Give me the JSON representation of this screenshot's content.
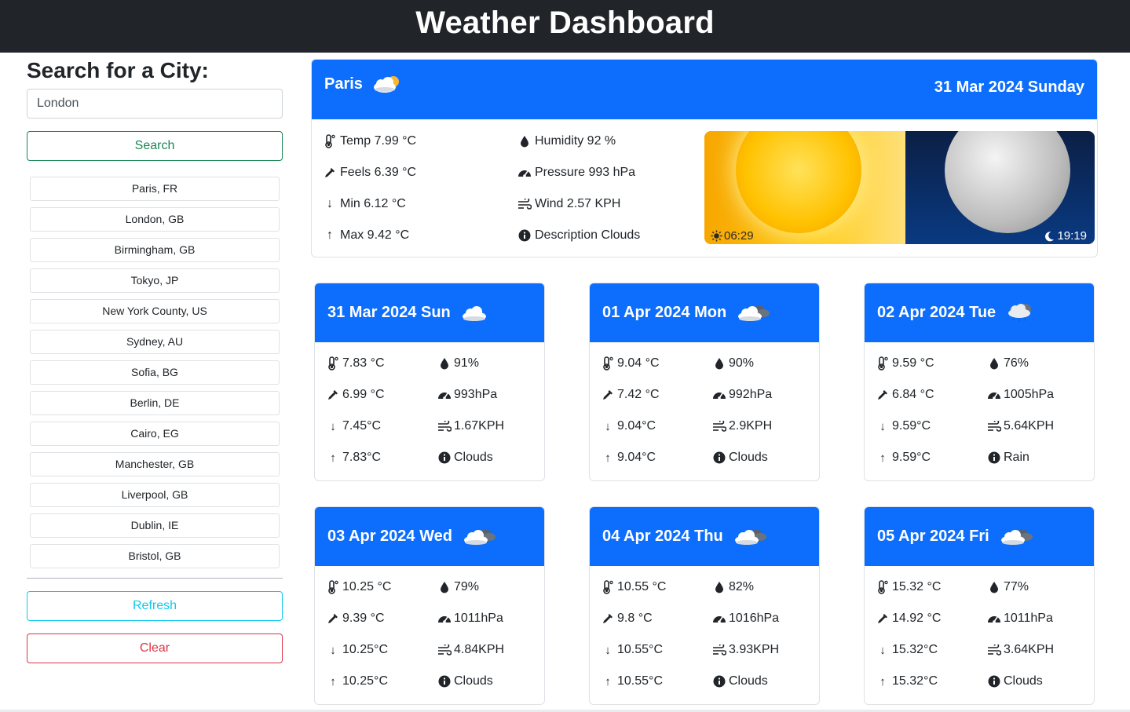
{
  "app": {
    "title": "Weather Dashboard"
  },
  "search": {
    "heading": "Search for a City:",
    "value": "London",
    "search_label": "Search",
    "refresh_label": "Refresh",
    "clear_label": "Clear"
  },
  "history": [
    "Paris, FR",
    "London, GB",
    "Birmingham, GB",
    "Tokyo, JP",
    "New York County, US",
    "Sydney, AU",
    "Sofia, BG",
    "Berlin, DE",
    "Cairo, EG",
    "Manchester, GB",
    "Liverpool, GB",
    "Dublin, IE",
    "Bristol, GB"
  ],
  "current": {
    "city": "Paris",
    "date": "31 Mar 2024 Sunday",
    "icon": "cloud-sun-icon",
    "temp": "Temp 7.99 °C",
    "feels": "Feels 6.39 °C",
    "min": "Min 6.12 °C",
    "max": "Max 9.42 °C",
    "humidity": "Humidity 92 %",
    "pressure": "Pressure 993 hPa",
    "wind": "Wind 2.57 KPH",
    "description": "Description Clouds",
    "sunrise": "06:29",
    "sunset": "19:19"
  },
  "forecast": [
    {
      "date": "31 Mar 2024 Sun",
      "icon": "cloud-icon",
      "temp": "7.83 °C",
      "feels": "6.99 °C",
      "min": "7.45°C",
      "max": "7.83°C",
      "humidity": "91%",
      "pressure": "993hPa",
      "wind": "1.67KPH",
      "desc": "Clouds"
    },
    {
      "date": "01 Apr 2024 Mon",
      "icon": "cloud-dark-icon",
      "temp": "9.04 °C",
      "feels": "7.42 °C",
      "min": "9.04°C",
      "max": "9.04°C",
      "humidity": "90%",
      "pressure": "992hPa",
      "wind": "2.9KPH",
      "desc": "Clouds"
    },
    {
      "date": "02 Apr 2024 Tue",
      "icon": "rain-cloud-icon",
      "temp": "9.59 °C",
      "feels": "6.84 °C",
      "min": "9.59°C",
      "max": "9.59°C",
      "humidity": "76%",
      "pressure": "1005hPa",
      "wind": "5.64KPH",
      "desc": "Rain"
    },
    {
      "date": "03 Apr 2024 Wed",
      "icon": "cloud-dark-icon",
      "temp": "10.25 °C",
      "feels": "9.39 °C",
      "min": "10.25°C",
      "max": "10.25°C",
      "humidity": "79%",
      "pressure": "1011hPa",
      "wind": "4.84KPH",
      "desc": "Clouds"
    },
    {
      "date": "04 Apr 2024 Thu",
      "icon": "cloud-dark-icon",
      "temp": "10.55 °C",
      "feels": "9.8 °C",
      "min": "10.55°C",
      "max": "10.55°C",
      "humidity": "82%",
      "pressure": "1016hPa",
      "wind": "3.93KPH",
      "desc": "Clouds"
    },
    {
      "date": "05 Apr 2024 Fri",
      "icon": "cloud-dark-icon",
      "temp": "15.32 °C",
      "feels": "14.92 °C",
      "min": "15.32°C",
      "max": "15.32°C",
      "humidity": "77%",
      "pressure": "1011hPa",
      "wind": "3.64KPH",
      "desc": "Clouds"
    }
  ],
  "colors": {
    "header": "#212529",
    "primary": "#0d6efd",
    "success": "#198754",
    "info": "#0dcaf0",
    "danger": "#dc3545"
  }
}
